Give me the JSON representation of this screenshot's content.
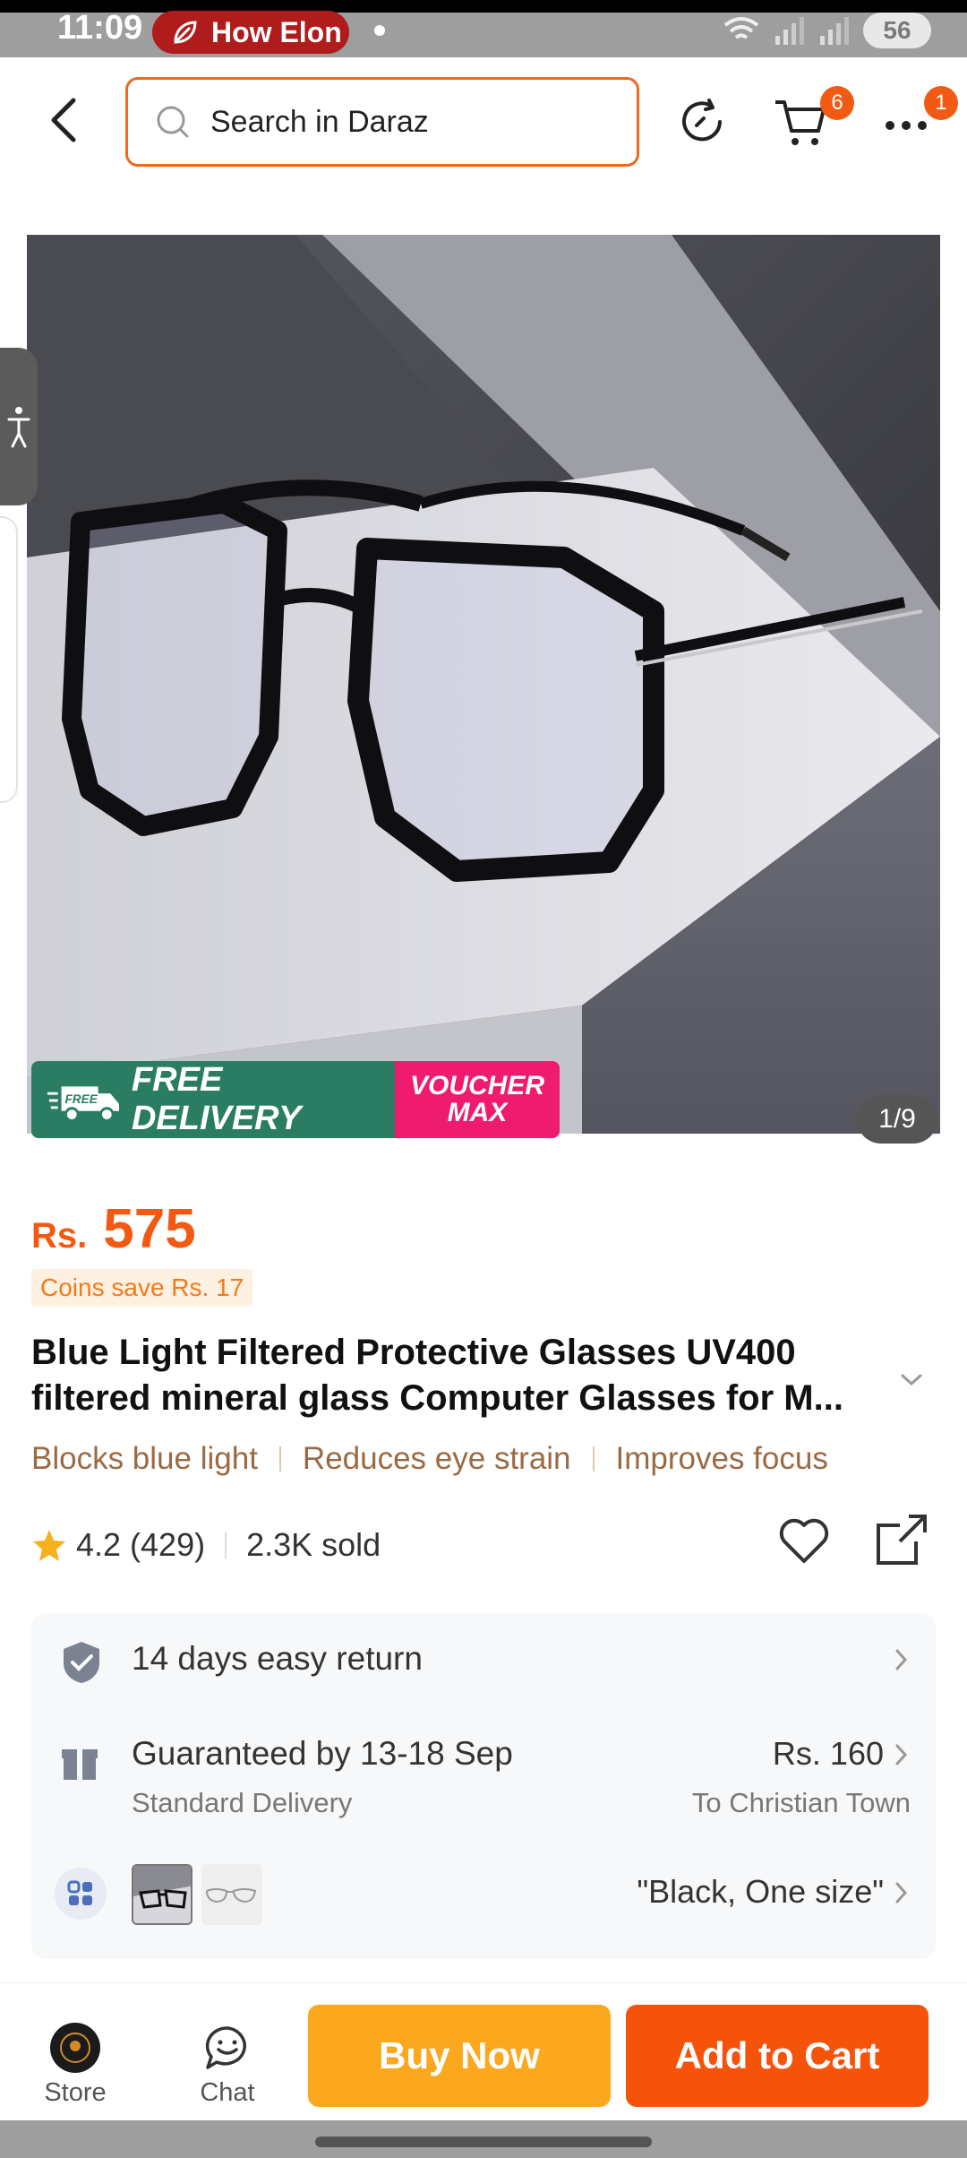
{
  "status_bar": {
    "time": "11:09",
    "notification_pill": "How Elon",
    "battery": "56"
  },
  "header": {
    "search_placeholder": "Search in Daraz",
    "cart_badge": "6",
    "menu_badge": "1"
  },
  "gallery": {
    "promo_free_label": "FREE DELIVERY",
    "promo_free_tag": "FREE",
    "promo_voucher_line1": "VOUCHER",
    "promo_voucher_line2": "MAX",
    "counter": "1/9"
  },
  "product": {
    "currency": "Rs.",
    "price": "575",
    "coins_save": "Coins save Rs. 17",
    "title": "Blue Light Filtered Protective Glasses UV400 filtered mineral glass Computer Glasses for M...",
    "features": [
      "Blocks blue light",
      "Reduces eye strain",
      "Improves focus"
    ],
    "rating": "4.2",
    "reviews": "(429)",
    "sold": "2.3K sold"
  },
  "info_card": {
    "return_label": "14 days easy return",
    "delivery_label": "Guaranteed by 13-18 Sep",
    "delivery_sub": "Standard Delivery",
    "delivery_price": "Rs. 160",
    "delivery_to": "To Christian Town",
    "variant_label": "\"Black, One size\""
  },
  "bottom_bar": {
    "store_label": "Store",
    "chat_label": "Chat",
    "buy_now": "Buy Now",
    "add_to_cart": "Add to Cart"
  },
  "colors": {
    "accent": "#f25a13",
    "buy_now": "#fba81f",
    "add_to_cart": "#f5530a",
    "feature_text": "#9b6a43",
    "free_delivery": "#2a7d63",
    "voucher": "#ee1b6f"
  }
}
